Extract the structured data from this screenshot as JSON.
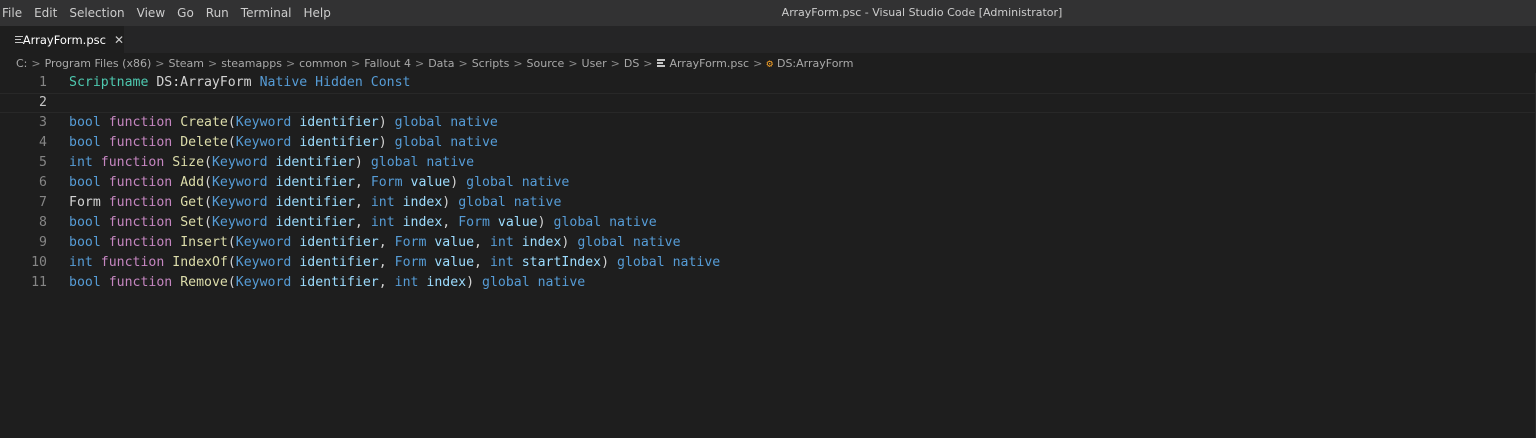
{
  "menu": [
    {
      "label": "File",
      "name": "menu-file"
    },
    {
      "label": "Edit",
      "name": "menu-edit"
    },
    {
      "label": "Selection",
      "name": "menu-selection"
    },
    {
      "label": "View",
      "name": "menu-view"
    },
    {
      "label": "Go",
      "name": "menu-go"
    },
    {
      "label": "Run",
      "name": "menu-run"
    },
    {
      "label": "Terminal",
      "name": "menu-terminal"
    },
    {
      "label": "Help",
      "name": "menu-help"
    }
  ],
  "window_title": "ArrayForm.psc - Visual Studio Code [Administrator]",
  "tab": {
    "label": "ArrayForm.psc",
    "close": "✕",
    "icon": "file-lines-icon"
  },
  "breadcrumbs": [
    "C:",
    "Program Files (x86)",
    "Steam",
    "steamapps",
    "common",
    "Fallout 4",
    "Data",
    "Scripts",
    "Source",
    "User",
    "DS"
  ],
  "breadcrumb_file": "ArrayForm.psc",
  "breadcrumb_symbol": "DS:ArrayForm",
  "breadcrumb_separator": ">",
  "colors": {
    "keyword": "#c586c0",
    "type": "#569cd6",
    "function": "#dcdcaa",
    "parameter": "#9cdcfe",
    "class": "#4ec9b0",
    "plain": "#d4d4d4"
  },
  "editor": {
    "current_line": 2,
    "lines": [
      {
        "number": "1",
        "tokens": [
          [
            "Scriptname",
            "cls"
          ],
          [
            " DS:ArrayForm ",
            "plain"
          ],
          [
            "Native",
            "type"
          ],
          [
            " ",
            "plain"
          ],
          [
            "Hidden",
            "type"
          ],
          [
            " ",
            "plain"
          ],
          [
            "Const",
            "type"
          ]
        ]
      },
      {
        "number": "2",
        "tokens": []
      },
      {
        "number": "3",
        "tokens": [
          [
            "bool",
            "type"
          ],
          [
            " ",
            "plain"
          ],
          [
            "function",
            "ctrl"
          ],
          [
            " ",
            "plain"
          ],
          [
            "Create",
            "fn"
          ],
          [
            "(",
            "plain"
          ],
          [
            "Keyword",
            "type"
          ],
          [
            " ",
            "plain"
          ],
          [
            "identifier",
            "var"
          ],
          [
            ") ",
            "plain"
          ],
          [
            "global",
            "type"
          ],
          [
            " ",
            "plain"
          ],
          [
            "native",
            "type"
          ]
        ]
      },
      {
        "number": "4",
        "tokens": [
          [
            "bool",
            "type"
          ],
          [
            " ",
            "plain"
          ],
          [
            "function",
            "ctrl"
          ],
          [
            " ",
            "plain"
          ],
          [
            "Delete",
            "fn"
          ],
          [
            "(",
            "plain"
          ],
          [
            "Keyword",
            "type"
          ],
          [
            " ",
            "plain"
          ],
          [
            "identifier",
            "var"
          ],
          [
            ") ",
            "plain"
          ],
          [
            "global",
            "type"
          ],
          [
            " ",
            "plain"
          ],
          [
            "native",
            "type"
          ]
        ]
      },
      {
        "number": "5",
        "tokens": [
          [
            "int",
            "type"
          ],
          [
            " ",
            "plain"
          ],
          [
            "function",
            "ctrl"
          ],
          [
            " ",
            "plain"
          ],
          [
            "Size",
            "fn"
          ],
          [
            "(",
            "plain"
          ],
          [
            "Keyword",
            "type"
          ],
          [
            " ",
            "plain"
          ],
          [
            "identifier",
            "var"
          ],
          [
            ") ",
            "plain"
          ],
          [
            "global",
            "type"
          ],
          [
            " ",
            "plain"
          ],
          [
            "native",
            "type"
          ]
        ]
      },
      {
        "number": "6",
        "tokens": [
          [
            "bool",
            "type"
          ],
          [
            " ",
            "plain"
          ],
          [
            "function",
            "ctrl"
          ],
          [
            " ",
            "plain"
          ],
          [
            "Add",
            "fn"
          ],
          [
            "(",
            "plain"
          ],
          [
            "Keyword",
            "type"
          ],
          [
            " ",
            "plain"
          ],
          [
            "identifier",
            "var"
          ],
          [
            ", ",
            "plain"
          ],
          [
            "Form",
            "type"
          ],
          [
            " ",
            "plain"
          ],
          [
            "value",
            "var"
          ],
          [
            ") ",
            "plain"
          ],
          [
            "global",
            "type"
          ],
          [
            " ",
            "plain"
          ],
          [
            "native",
            "type"
          ]
        ]
      },
      {
        "number": "7",
        "tokens": [
          [
            "Form",
            "plain"
          ],
          [
            " ",
            "plain"
          ],
          [
            "function",
            "ctrl"
          ],
          [
            " ",
            "plain"
          ],
          [
            "Get",
            "fn"
          ],
          [
            "(",
            "plain"
          ],
          [
            "Keyword",
            "type"
          ],
          [
            " ",
            "plain"
          ],
          [
            "identifier",
            "var"
          ],
          [
            ", ",
            "plain"
          ],
          [
            "int",
            "type"
          ],
          [
            " ",
            "plain"
          ],
          [
            "index",
            "var"
          ],
          [
            ") ",
            "plain"
          ],
          [
            "global",
            "type"
          ],
          [
            " ",
            "plain"
          ],
          [
            "native",
            "type"
          ]
        ]
      },
      {
        "number": "8",
        "tokens": [
          [
            "bool",
            "type"
          ],
          [
            " ",
            "plain"
          ],
          [
            "function",
            "ctrl"
          ],
          [
            " ",
            "plain"
          ],
          [
            "Set",
            "fn"
          ],
          [
            "(",
            "plain"
          ],
          [
            "Keyword",
            "type"
          ],
          [
            " ",
            "plain"
          ],
          [
            "identifier",
            "var"
          ],
          [
            ", ",
            "plain"
          ],
          [
            "int",
            "type"
          ],
          [
            " ",
            "plain"
          ],
          [
            "index",
            "var"
          ],
          [
            ", ",
            "plain"
          ],
          [
            "Form",
            "type"
          ],
          [
            " ",
            "plain"
          ],
          [
            "value",
            "var"
          ],
          [
            ") ",
            "plain"
          ],
          [
            "global",
            "type"
          ],
          [
            " ",
            "plain"
          ],
          [
            "native",
            "type"
          ]
        ]
      },
      {
        "number": "9",
        "tokens": [
          [
            "bool",
            "type"
          ],
          [
            " ",
            "plain"
          ],
          [
            "function",
            "ctrl"
          ],
          [
            " ",
            "plain"
          ],
          [
            "Insert",
            "fn"
          ],
          [
            "(",
            "plain"
          ],
          [
            "Keyword",
            "type"
          ],
          [
            " ",
            "plain"
          ],
          [
            "identifier",
            "var"
          ],
          [
            ", ",
            "plain"
          ],
          [
            "Form",
            "type"
          ],
          [
            " ",
            "plain"
          ],
          [
            "value",
            "var"
          ],
          [
            ", ",
            "plain"
          ],
          [
            "int",
            "type"
          ],
          [
            " ",
            "plain"
          ],
          [
            "index",
            "var"
          ],
          [
            ") ",
            "plain"
          ],
          [
            "global",
            "type"
          ],
          [
            " ",
            "plain"
          ],
          [
            "native",
            "type"
          ]
        ]
      },
      {
        "number": "10",
        "tokens": [
          [
            "int",
            "type"
          ],
          [
            " ",
            "plain"
          ],
          [
            "function",
            "ctrl"
          ],
          [
            " ",
            "plain"
          ],
          [
            "IndexOf",
            "fn"
          ],
          [
            "(",
            "plain"
          ],
          [
            "Keyword",
            "type"
          ],
          [
            " ",
            "plain"
          ],
          [
            "identifier",
            "var"
          ],
          [
            ", ",
            "plain"
          ],
          [
            "Form",
            "type"
          ],
          [
            " ",
            "plain"
          ],
          [
            "value",
            "var"
          ],
          [
            ", ",
            "plain"
          ],
          [
            "int",
            "type"
          ],
          [
            " ",
            "plain"
          ],
          [
            "startIndex",
            "var"
          ],
          [
            ") ",
            "plain"
          ],
          [
            "global",
            "type"
          ],
          [
            " ",
            "plain"
          ],
          [
            "native",
            "type"
          ]
        ]
      },
      {
        "number": "11",
        "tokens": [
          [
            "bool",
            "type"
          ],
          [
            " ",
            "plain"
          ],
          [
            "function",
            "ctrl"
          ],
          [
            " ",
            "plain"
          ],
          [
            "Remove",
            "fn"
          ],
          [
            "(",
            "plain"
          ],
          [
            "Keyword",
            "type"
          ],
          [
            " ",
            "plain"
          ],
          [
            "identifier",
            "var"
          ],
          [
            ", ",
            "plain"
          ],
          [
            "int",
            "type"
          ],
          [
            " ",
            "plain"
          ],
          [
            "index",
            "var"
          ],
          [
            ") ",
            "plain"
          ],
          [
            "global",
            "type"
          ],
          [
            " ",
            "plain"
          ],
          [
            "native",
            "type"
          ]
        ]
      }
    ]
  }
}
